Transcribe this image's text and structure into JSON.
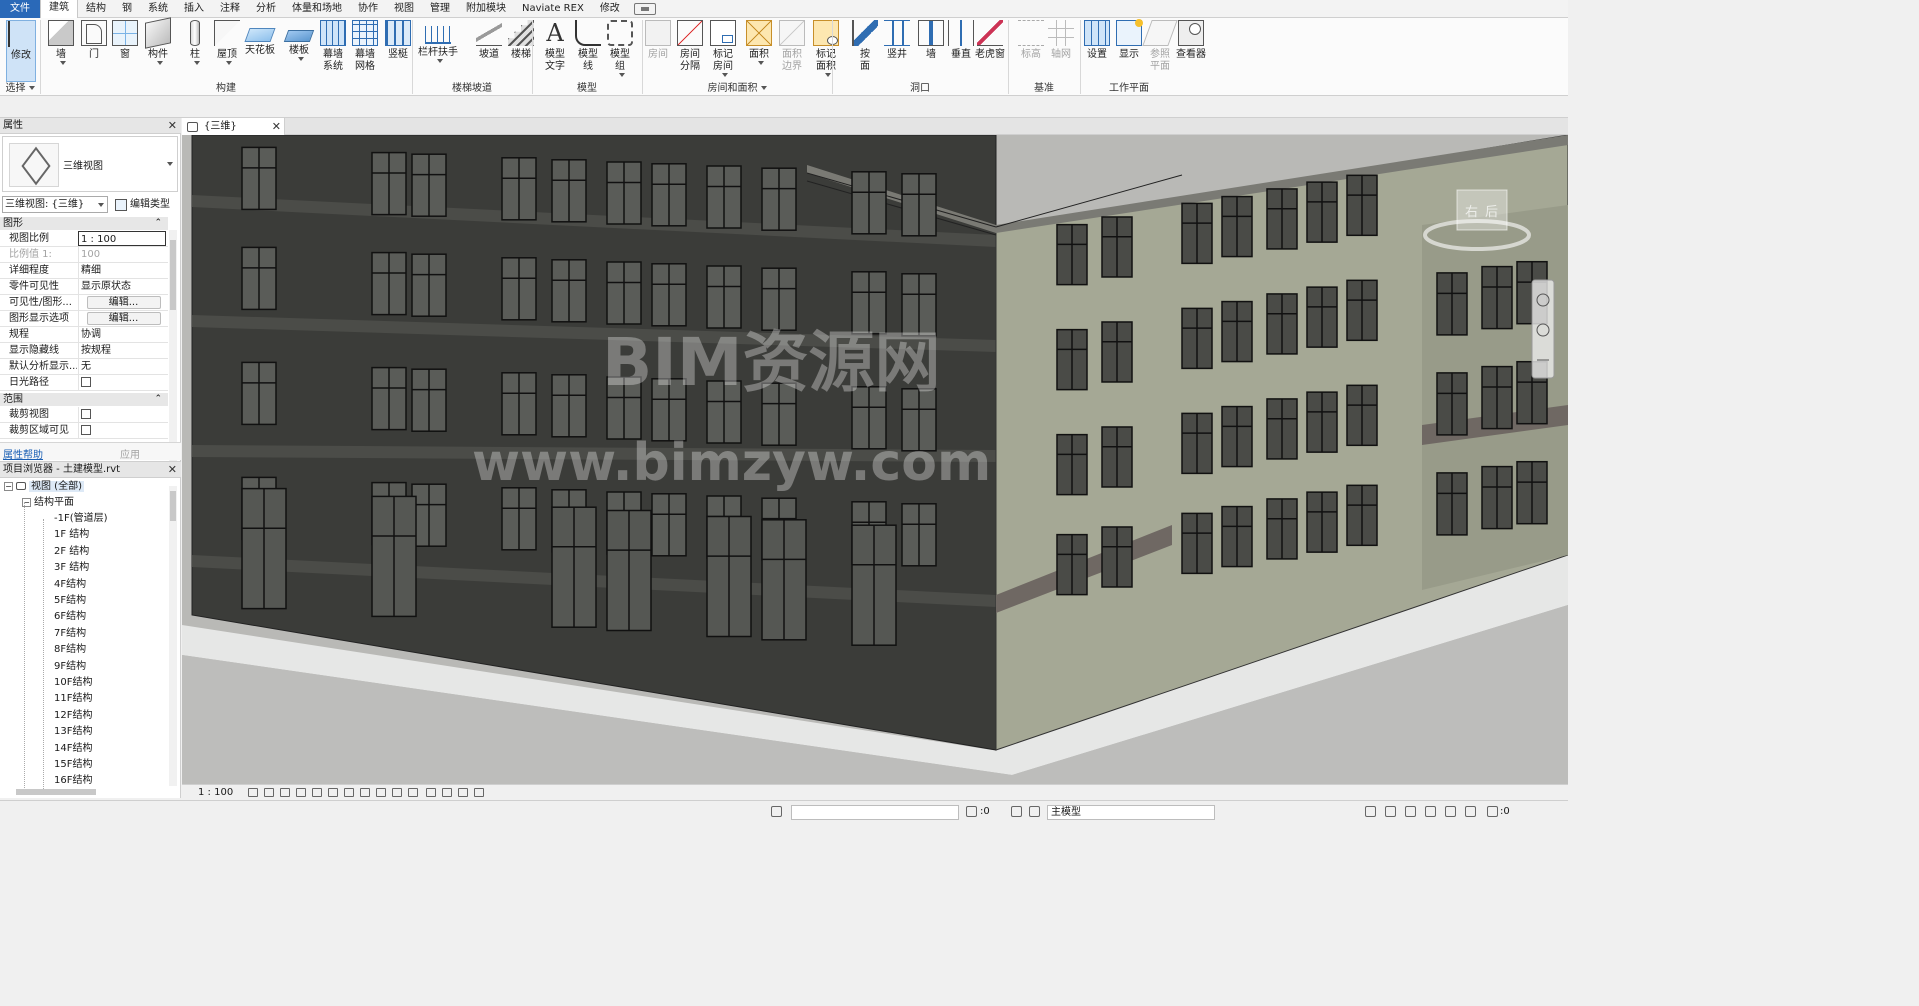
{
  "menu": {
    "tabs": [
      "文件",
      "建筑",
      "结构",
      "钢",
      "系统",
      "插入",
      "注释",
      "分析",
      "体量和场地",
      "协作",
      "视图",
      "管理",
      "附加模块",
      "Naviate REX",
      "修改"
    ],
    "active_index": 1
  },
  "ribbon": {
    "tools": [
      {
        "id": "modify",
        "label": "修改",
        "icon": "cursor-icon",
        "selected": true
      },
      {
        "id": "wall",
        "label": "墙",
        "icon": "wall-icon",
        "dropdown": true
      },
      {
        "id": "door",
        "label": "门",
        "icon": "door-icon"
      },
      {
        "id": "window",
        "label": "窗",
        "icon": "window-icon"
      },
      {
        "id": "component",
        "label": "构件",
        "icon": "component-icon",
        "dropdown": true
      },
      {
        "id": "column",
        "label": "柱",
        "icon": "column-icon",
        "dropdown": true
      },
      {
        "id": "roof",
        "label": "屋顶",
        "icon": "roof-icon",
        "dropdown": true
      },
      {
        "id": "ceiling",
        "label": "天花板",
        "icon": "ceiling-icon"
      },
      {
        "id": "floor",
        "label": "楼板",
        "icon": "floor-icon",
        "dropdown": true
      },
      {
        "id": "curtain-system",
        "label": "幕墙\n系统",
        "icon": "curtain-system-icon"
      },
      {
        "id": "curtain-grid",
        "label": "幕墙\n网格",
        "icon": "curtain-grid-icon"
      },
      {
        "id": "mullion",
        "label": "竖梃",
        "icon": "mullion-icon"
      },
      {
        "id": "railing",
        "label": "栏杆扶手",
        "icon": "railing-icon",
        "dropdown": true
      },
      {
        "id": "ramp",
        "label": "坡道",
        "icon": "ramp-icon"
      },
      {
        "id": "stair",
        "label": "楼梯",
        "icon": "stair-icon"
      },
      {
        "id": "model-text",
        "label": "模型\n文字",
        "icon": "model-text-icon"
      },
      {
        "id": "model-line",
        "label": "模型\n线",
        "icon": "model-line-icon"
      },
      {
        "id": "model-group",
        "label": "模型\n组",
        "icon": "model-group-icon",
        "dropdown": true
      },
      {
        "id": "room",
        "label": "房间",
        "icon": "room-icon",
        "disabled": true
      },
      {
        "id": "room-separator",
        "label": "房间\n分隔",
        "icon": "room-separator-icon"
      },
      {
        "id": "tag-room",
        "label": "标记\n房间",
        "icon": "tag-room-icon",
        "dropdown": true
      },
      {
        "id": "area",
        "label": "面积",
        "icon": "area-icon",
        "dropdown": true
      },
      {
        "id": "area-boundary",
        "label": "面积\n边界",
        "icon": "area-boundary-icon",
        "disabled": true
      },
      {
        "id": "tag-area",
        "label": "标记\n面积",
        "icon": "tag-area-icon",
        "dropdown": true
      },
      {
        "id": "by-face",
        "label": "按\n面",
        "icon": "by-face-icon"
      },
      {
        "id": "shaft",
        "label": "竖井",
        "icon": "shaft-icon"
      },
      {
        "id": "opening-wall",
        "label": "墙",
        "icon": "wall-opening-icon"
      },
      {
        "id": "vertical",
        "label": "垂直",
        "icon": "vertical-opening-icon"
      },
      {
        "id": "dormer",
        "label": "老虎窗",
        "icon": "dormer-icon"
      },
      {
        "id": "level",
        "label": "标高",
        "icon": "level-icon",
        "disabled": true
      },
      {
        "id": "grid",
        "label": "轴网",
        "icon": "grid-icon",
        "disabled": true
      },
      {
        "id": "set",
        "label": "设置",
        "icon": "set-workplane-icon"
      },
      {
        "id": "show",
        "label": "显示",
        "icon": "show-workplane-icon"
      },
      {
        "id": "ref-plane",
        "label": "参照\n平面",
        "icon": "ref-plane-icon",
        "disabled": true
      },
      {
        "id": "viewer",
        "label": "查看器",
        "icon": "viewer-icon"
      }
    ],
    "groups": [
      "选择",
      "构建",
      "楼梯坡道",
      "模型",
      "房间和面积",
      "洞口",
      "基准",
      "工作平面"
    ]
  },
  "properties": {
    "title": "属性",
    "type_name": "三维视图",
    "view_selector": "三维视图: {三维}",
    "edit_type": "编辑类型",
    "groups": [
      {
        "name": "图形",
        "rows": [
          {
            "k": "视图比例",
            "v": "1 : 100",
            "boxed": true
          },
          {
            "k": "比例值 1:",
            "v": "100",
            "disabled": true
          },
          {
            "k": "详细程度",
            "v": "精细"
          },
          {
            "k": "零件可见性",
            "v": "显示原状态"
          },
          {
            "k": "可见性/图形...",
            "v": "编辑...",
            "button": true
          },
          {
            "k": "图形显示选项",
            "v": "编辑...",
            "button": true
          },
          {
            "k": "规程",
            "v": "协调"
          },
          {
            "k": "显示隐藏线",
            "v": "按规程"
          },
          {
            "k": "默认分析显示...",
            "v": "无"
          },
          {
            "k": "日光路径",
            "v": "",
            "checkbox": true
          }
        ]
      },
      {
        "name": "范围",
        "rows": [
          {
            "k": "裁剪视图",
            "v": "",
            "checkbox": true
          },
          {
            "k": "裁剪区域可见",
            "v": "",
            "checkbox": true
          }
        ]
      }
    ],
    "help_link": "属性帮助",
    "apply": "应用"
  },
  "browser": {
    "title": "项目浏览器 - 土建模型.rvt",
    "root": "视图 (全部)",
    "category": "结构平面",
    "items": [
      "-1F(管道层)",
      "1F 结构",
      "2F 结构",
      "3F 结构",
      "4F结构",
      "5F结构",
      "6F结构",
      "7F结构",
      "8F结构",
      "9F结构",
      "10F结构",
      "11F结构",
      "12F结构",
      "13F结构",
      "14F结构",
      "15F结构",
      "16F结构"
    ]
  },
  "viewport": {
    "tab_label": "{三维}",
    "viewcube": {
      "left": "右",
      "front": "后"
    },
    "watermark": [
      "BIM资源网",
      "www.bimzyw.com"
    ],
    "scale": "1 : 100"
  },
  "status": {
    "filter_count": ":0",
    "model_selector": "主模型",
    "right_count": ":0"
  },
  "colors": {
    "accent": "#2a69b8",
    "facade_dark": "#3b3c39",
    "facade_light": "#a5a895"
  }
}
